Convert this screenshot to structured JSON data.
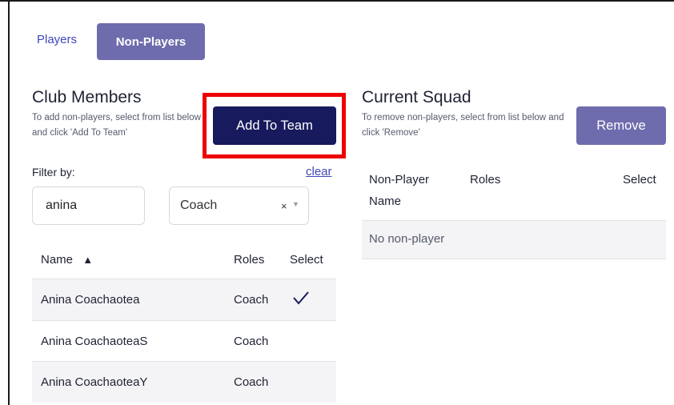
{
  "tabs": [
    {
      "label": "Players",
      "active": false
    },
    {
      "label": "Non-Players",
      "active": true
    }
  ],
  "club_members": {
    "title": "Club Members",
    "hint": "To add non-players, select from list below and click 'Add To Team'",
    "add_button": "Add To Team",
    "filter_label": "Filter by:",
    "clear_label": "clear",
    "search_value": "anina",
    "role_value": "Coach",
    "role_clear_glyph": "×",
    "role_caret_glyph": "▼",
    "columns": {
      "name": "Name",
      "sort_glyph": "▲",
      "roles": "Roles",
      "select": "Select"
    },
    "rows": [
      {
        "name": "Anina Coachaotea",
        "role": "Coach",
        "selected": true
      },
      {
        "name": "Anina CoachaoteaS",
        "role": "Coach",
        "selected": false
      },
      {
        "name": "Anina CoachaoteaY",
        "role": "Coach",
        "selected": false
      }
    ]
  },
  "current_squad": {
    "title": "Current Squad",
    "hint": "To remove non-players, select from list below and click 'Remove'",
    "remove_button": "Remove",
    "columns": {
      "name_line1": "Non-Player",
      "name_line2": "Name",
      "roles": "Roles",
      "select": "Select"
    },
    "empty_text": "No non-player"
  },
  "colors": {
    "primary_dark": "#181a5e",
    "primary_muted": "#6e6cad",
    "link": "#3f48b8",
    "highlight": "#ee0000"
  }
}
